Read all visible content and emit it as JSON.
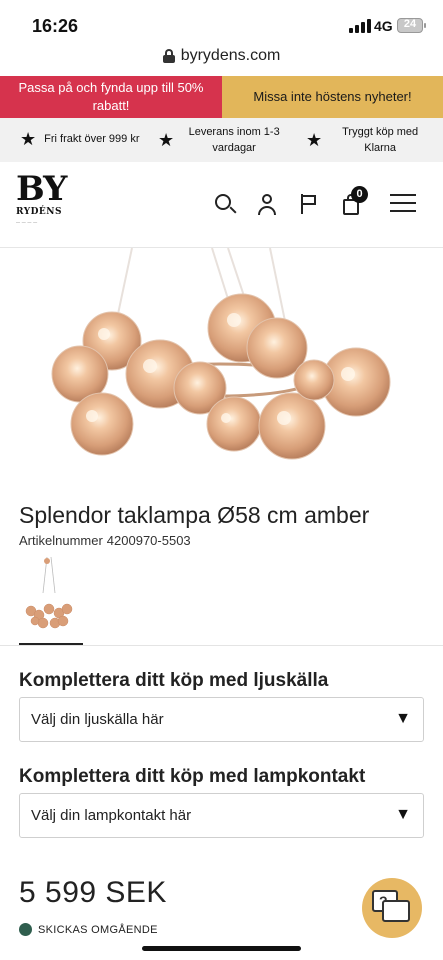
{
  "status_bar": {
    "time": "16:26",
    "network": "4G",
    "battery": "24"
  },
  "browser": {
    "url": "byrydens.com"
  },
  "promo": {
    "left_text": "Passa på och fynda upp till 50% rabatt!",
    "right_text": "Missa inte höstens nyheter!",
    "left_color": "#d6334d",
    "right_color": "#e2b65a"
  },
  "usps": [
    {
      "icon": "star-icon",
      "text": "Fri frakt över 999 kr"
    },
    {
      "icon": "star-icon",
      "text": "Leverans inom 1-3 vardagar"
    },
    {
      "icon": "star-icon",
      "text": "Tryggt köp med Klarna"
    }
  ],
  "header": {
    "logo_top": "BY",
    "logo_bottom": "RYDÉNS",
    "icons": [
      "search-icon",
      "user-icon",
      "flag-icon",
      "cart-icon",
      "menu-icon"
    ],
    "cart_count": "0"
  },
  "product": {
    "title": "Splendor taklampa Ø58 cm amber",
    "article_label": "Artikelnummer",
    "article_number": "4200970-5503",
    "price": "5 599 SEK",
    "stock_status": "SKICKAS OMGÅENDE",
    "stock_color": "#2f5e4e"
  },
  "addons": [
    {
      "heading": "Komplettera ditt köp med ljuskälla",
      "placeholder": "Välj din ljuskälla här"
    },
    {
      "heading": "Komplettera ditt köp med lampkontakt",
      "placeholder": "Välj din lampkontakt här"
    }
  ],
  "chat": {
    "icon": "chat-icon",
    "glyph": "?",
    "color": "#e7b864"
  }
}
